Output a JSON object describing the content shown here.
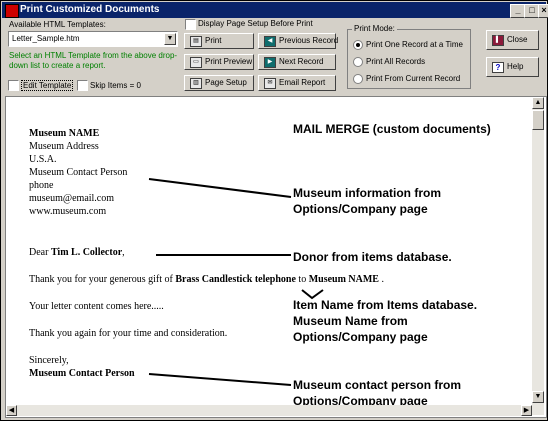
{
  "window": {
    "title": "Print Customized Documents"
  },
  "templates": {
    "label": "Available HTML Templates:",
    "selected": "Letter_Sample.htm",
    "hint": "Select an HTML Template from the above drop-down list to create a report.",
    "edit_template": "Edit Template",
    "skip_items": "Skip Items = 0"
  },
  "options": {
    "display_page_setup": "Display Page Setup Before Print"
  },
  "buttons": {
    "print": "Print",
    "print_preview": "Print Preview",
    "page_setup": "Page Setup",
    "previous_record": "Previous Record",
    "next_record": "Next Record",
    "email_report": "Email Report",
    "close": "Close",
    "help": "Help"
  },
  "print_mode": {
    "label": "Print Mode:",
    "options": [
      "Print One Record at a Time",
      "Print All Records",
      "Print From Current Record"
    ],
    "selected": "Print One Record at a Time"
  },
  "letter": {
    "org_name": "Museum NAME",
    "address": "Museum Address",
    "country": "U.S.A.",
    "contact": "Museum Contact Person",
    "phone": "phone",
    "email": "museum@email.com",
    "website": "www.museum.com",
    "salutation": "Dear",
    "donor": "Tim L. Collector",
    "salutation_end": ",",
    "thanks_prefix": "Thank you for your generous gift of",
    "item_name": "Brass Candlestick telephone",
    "thanks_to": "to",
    "thanks_org": "Museum NAME",
    "thanks_end": ".",
    "content": "Your letter content comes here.....",
    "thanks_again": "Thank you again for your time and consideration.",
    "closing": "Sincerely,",
    "signature": "Museum Contact Person"
  },
  "annotations": {
    "title": "MAIL MERGE (custom documents)",
    "museum_info_1": "Museum information from",
    "museum_info_2": "Options/Company page",
    "donor": "Donor from items database.",
    "item_name": "Item Name from Items database.",
    "museum_name_1": "Museum Name from",
    "museum_name_2": "Options/Company page",
    "contact_1": "Museum contact person from",
    "contact_2": "Options/Company page"
  }
}
